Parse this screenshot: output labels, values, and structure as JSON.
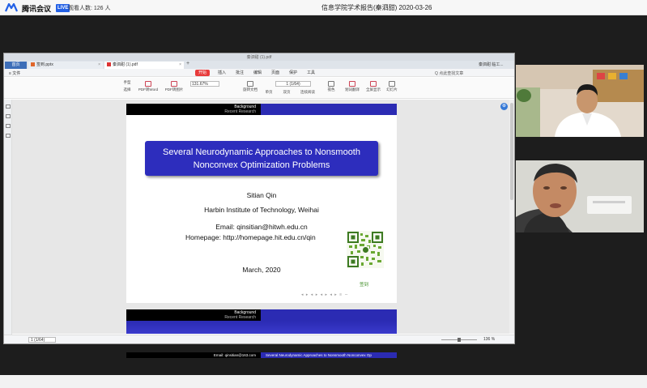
{
  "topbar": {
    "app_name": "腾讯会议",
    "live_badge": "LIVE",
    "viewers": "观看人数: 126 人",
    "meeting_title": "信息学院学术报告(秦泗甜) 2020-03-26"
  },
  "viewer": {
    "window_title": "秦泗甜 (1).pdf",
    "tabs": [
      {
        "label": "首页"
      },
      {
        "label": "签到.pptx"
      },
      {
        "label": "秦泗甜 (1).pdf"
      }
    ],
    "new_tab": "+",
    "user": "秦泗甜 临工...",
    "menu_left": "≡ 文件",
    "menu": [
      "开始",
      "插入",
      "批注",
      "编辑",
      "页面",
      "保护",
      "工具"
    ],
    "search": "Q 点此查找文章",
    "toolbar": {
      "hand": "手型",
      "select": "选择",
      "pdf_to_word": "PDF转Word",
      "pdf_to_image": "PDF转图片",
      "zoom": "131.67%",
      "rotate": "旋转文档",
      "single_page": "单页",
      "double_page": "双页",
      "continuous": "连续阅读",
      "page": "1 (1/64)",
      "read_mode": "夜色",
      "translate": "划词翻译",
      "fullscreen": "全屏显示",
      "play": "幻灯片"
    },
    "status": {
      "page": "1 (1/64)",
      "zoom": "136 %"
    }
  },
  "slide": {
    "header_line1": "Background",
    "header_line2": "Recent Research",
    "title_line1": "Several Neurodynamic Approaches to Nonsmooth",
    "title_line2": "Nonconvex Optimization Problems",
    "author": "Sitian Qin",
    "institute": "Harbin Institute of Technology, Weihai",
    "email": "Email:  qinsitian@hitwh.edu.cn",
    "homepage": "Homepage:  http://homepage.hit.edu.cn/qin",
    "date": "March, 2020",
    "qr_caption": "签到",
    "footer_left": "Email:  qinsitian@163.com",
    "footer_right": "Several Neurodynamic Approaches to Nonsmooth Nonconvex Op"
  },
  "colors": {
    "beamer_blue": "#2d2dbd",
    "live_blue": "#2461e6",
    "accent_red": "#e83b3b"
  }
}
